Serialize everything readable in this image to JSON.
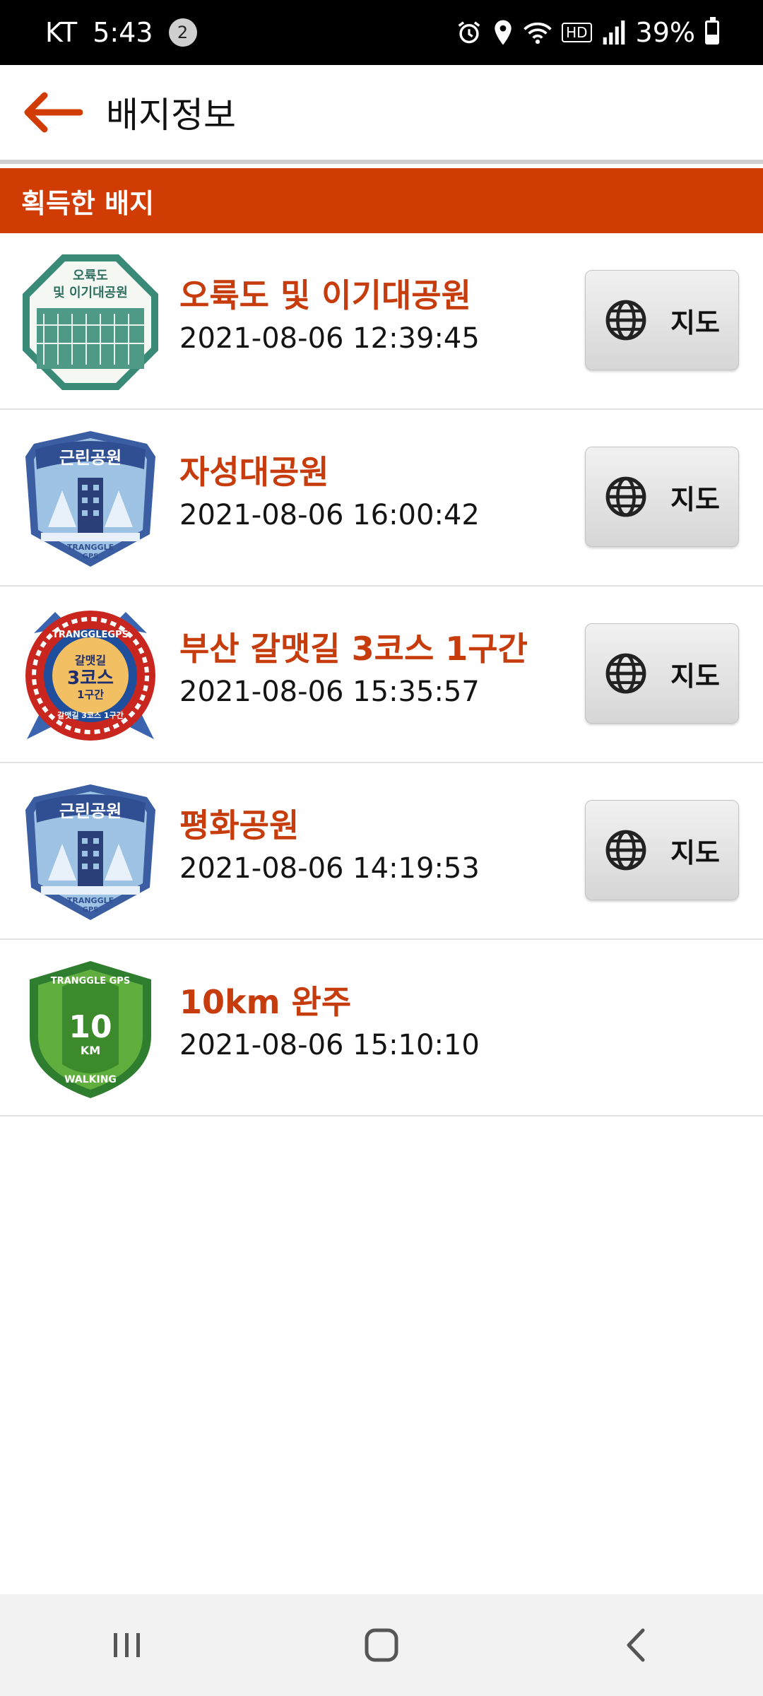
{
  "status_bar": {
    "carrier": "KT",
    "time": "5:43",
    "notification_count": "2",
    "hd_label": "HD",
    "battery_percent": "39%",
    "battery_level": 0.39,
    "icons": [
      "alarm-icon",
      "location-icon",
      "wifi-icon",
      "hd-icon",
      "signal-icon",
      "battery-icon"
    ]
  },
  "app_bar": {
    "title": "배지정보",
    "back_icon": "back-arrow-icon"
  },
  "section": {
    "title": "획득한 배지"
  },
  "badges": [
    {
      "name": "오륙도 및 이기대공원",
      "date": "2021-08-06 12:39:45",
      "map_label": "지도",
      "has_map": true,
      "badge_art_text": [
        "오륙도",
        "및 이기대공원"
      ]
    },
    {
      "name": "자성대공원",
      "date": "2021-08-06 16:00:42",
      "map_label": "지도",
      "has_map": true,
      "badge_art_text": [
        "근린공원",
        "TRANGGLE",
        "GPS"
      ]
    },
    {
      "name": "부산 갈맷길 3코스 1구간",
      "date": "2021-08-06 15:35:57",
      "map_label": "지도",
      "has_map": true,
      "badge_art_text": [
        "TRANGGLEGPS",
        "갈맷길",
        "3코스",
        "1구간",
        "갈맷길 3코스 1구간"
      ]
    },
    {
      "name": "평화공원",
      "date": "2021-08-06 14:19:53",
      "map_label": "지도",
      "has_map": true,
      "badge_art_text": [
        "근린공원",
        "TRANGGLE",
        "GPS"
      ]
    },
    {
      "name": "10km 완주",
      "date": "2021-08-06 15:10:10",
      "has_map": false,
      "badge_art_text": [
        "TRANGGLE GPS",
        "10",
        "KM",
        "WALKING"
      ]
    }
  ],
  "colors": {
    "accent": "#d13c04",
    "badge_name": "#c73c0c",
    "status_bar": "#000000",
    "nav_bar": "#f2f2f2"
  },
  "nav_bar": {
    "icons": [
      "recent-apps-icon",
      "home-icon",
      "back-icon"
    ]
  }
}
